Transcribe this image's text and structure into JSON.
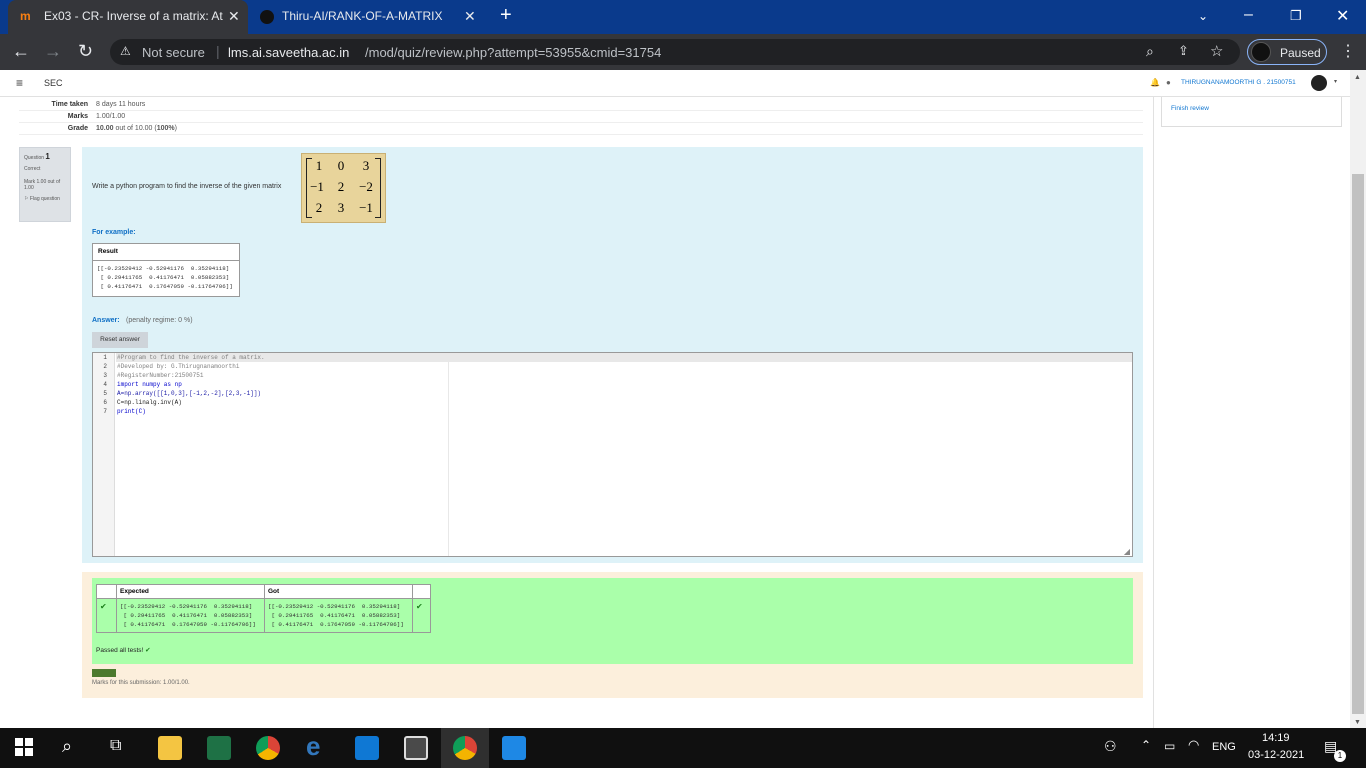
{
  "browser": {
    "tabs": [
      {
        "title": "Ex03 - CR- Inverse of a matrix: At",
        "active": true
      },
      {
        "title": "Thiru-AI/RANK-OF-A-MATRIX",
        "active": false
      }
    ],
    "new_tab": "+",
    "security": "Not secure",
    "url_host": "lms.ai.saveetha.ac.in",
    "url_path": "/mod/quiz/review.php?attempt=53955&cmid=31754",
    "profile_status": "Paused"
  },
  "moodle": {
    "menu_icon": "≡",
    "site_short": "SEC",
    "user_name": "THIRUGNANAMOORTHI G . 21500751",
    "finish_review": "Finish review"
  },
  "summary": [
    {
      "label": "Time taken",
      "value": "8 days 11 hours"
    },
    {
      "label": "Marks",
      "value": "1.00/1.00"
    },
    {
      "label": "Grade",
      "value_bold": "10.00",
      "value_rest": " out of 10.00 (",
      "percent": "100%",
      "close": ")"
    }
  ],
  "question": {
    "prefix": "Question",
    "number": "1",
    "state": "Correct",
    "mark": "Mark 1.00 out of 1.00",
    "flag": "Flag question",
    "text": "Write a python program to find the inverse of the given matrix",
    "matrix": [
      [
        "1",
        "0",
        "3"
      ],
      [
        "−1",
        "2",
        "−2"
      ],
      [
        "2",
        "3",
        "−1"
      ]
    ],
    "for_example": "For example:",
    "result_header": "Result",
    "result_lines": [
      "[[-0.23529412 -0.52941176  0.35294118]",
      " [ 0.29411765  0.41176471  0.05882353]",
      " [ 0.41176471  0.17647059 -0.11764706]]"
    ],
    "answer_label": "Answer:",
    "penalty": "(penalty regime: 0 %)",
    "reset_button": "Reset answer",
    "code_lines": [
      "#Program to find the inverse of a matrix.",
      "#Developed by: G.Thirugnanamoorthi",
      "#RegisterNumber:21500751",
      "import numpy as np",
      "A=np.array([[1,0,3],[-1,2,-2],[2,3,-1]])",
      "C=np.linalg.inv(A)",
      "print(C)"
    ]
  },
  "results": {
    "expected_header": "Expected",
    "got_header": "Got",
    "expected_lines": [
      "[[-0.23529412 -0.52941176  0.35294118]",
      " [ 0.29411765  0.41176471  0.05882353]",
      " [ 0.41176471  0.17647059 -0.11764706]]"
    ],
    "got_lines": [
      "[[-0.23529412 -0.52941176  0.35294118]",
      " [ 0.29411765  0.41176471  0.05882353]",
      " [ 0.41176471  0.17647059 -0.11764706]]"
    ],
    "passed": "Passed all tests!",
    "marks_submission": "Marks for this submission: 1.00/1.00."
  },
  "taskbar": {
    "language": "ENG",
    "time": "14:19",
    "date": "03-12-2021",
    "notifications": "1"
  },
  "colors": {
    "chrome_blue": "#0a3a8c",
    "question_bg": "#def2f8",
    "pass_green": "#aaffaa",
    "feedback_bg": "#fcefdc"
  }
}
